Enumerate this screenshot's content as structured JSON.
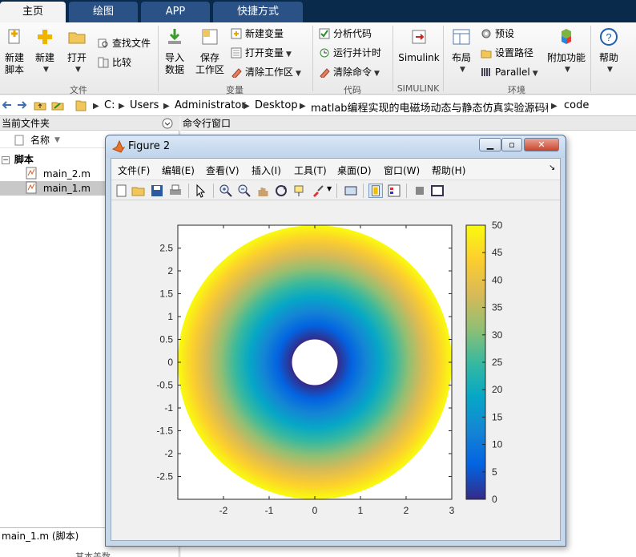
{
  "tabs": [
    {
      "label": "主页",
      "active": true
    },
    {
      "label": "绘图",
      "active": false
    },
    {
      "label": "APP",
      "active": false
    },
    {
      "label": "快捷方式",
      "active": false
    }
  ],
  "ribbon": {
    "file_group": {
      "label": "文件",
      "new_script": "新建\n脚本",
      "new_script_l1": "新建",
      "new_script_l2": "脚本",
      "new": "新建",
      "open": "打开",
      "find_files": "查找文件",
      "compare": "比较"
    },
    "variable_group": {
      "label": "变量",
      "import_l1": "导入",
      "import_l2": "数据",
      "save_l1": "保存",
      "save_l2": "工作区",
      "new_variable": "新建变量",
      "open_variable": "打开变量",
      "clear_workspace": "清除工作区"
    },
    "code_group": {
      "label": "代码",
      "analyze_code": "分析代码",
      "run_and_time": "运行并计时",
      "clear_commands": "清除命令"
    },
    "simulink_group": {
      "label": "SIMULINK",
      "simulink": "Simulink"
    },
    "environment_group": {
      "label": "环境",
      "layout": "布局",
      "preferences": "预设",
      "set_path": "设置路径",
      "parallel": "Parallel",
      "addons": "附加功能",
      "help": "帮助"
    }
  },
  "address": {
    "path": [
      "C:",
      "Users",
      "Administrator",
      "Desktop",
      "matlab编程实现的电磁场动态与静态仿真实验源码程序",
      "code"
    ]
  },
  "left_panel": {
    "title": "当前文件夹",
    "column_name": "名称",
    "folder": "脚本",
    "files": [
      {
        "name": "main_2.m",
        "selected": false
      },
      {
        "name": "main_1.m",
        "selected": true
      }
    ],
    "status": "main_1.m  (脚本)",
    "details_label": "其本盖数"
  },
  "right_panel": {
    "title": "命令行窗口"
  },
  "figure": {
    "title": "Figure 2",
    "menus": [
      "文件(F)",
      "编辑(E)",
      "查看(V)",
      "插入(I)",
      "工具(T)",
      "桌面(D)",
      "窗口(W)",
      "帮助(H)"
    ],
    "toolbar_icons": [
      "new-figure-icon",
      "open-icon",
      "save-icon",
      "print-icon",
      "pointer-icon",
      "zoom-in-icon",
      "zoom-out-icon",
      "pan-icon",
      "rotate-icon",
      "data-cursor-icon",
      "brush-icon",
      "link-icon",
      "colorbar-icon",
      "legend-icon",
      "hide-tools-icon",
      "dock-icon"
    ]
  },
  "chart_data": {
    "type": "heatmap",
    "description_shape": "annulus",
    "inner_radius": 0.5,
    "outer_radius": 3,
    "xlim": [
      -3,
      3
    ],
    "ylim": [
      -3,
      3
    ],
    "xticks": [
      -2,
      -1,
      0,
      1,
      2,
      3
    ],
    "yticks": [
      2.5,
      2,
      1.5,
      1,
      0.5,
      0,
      -0.5,
      -1,
      -1.5,
      -2,
      -2.5
    ],
    "colorbar": {
      "min": 0,
      "max": 50,
      "ticks": [
        50,
        45,
        40,
        35,
        30,
        25,
        20,
        15,
        10,
        5,
        0
      ],
      "colormap": "parula"
    },
    "value_at_inner_radius": 0,
    "value_at_outer_radius": 50
  }
}
